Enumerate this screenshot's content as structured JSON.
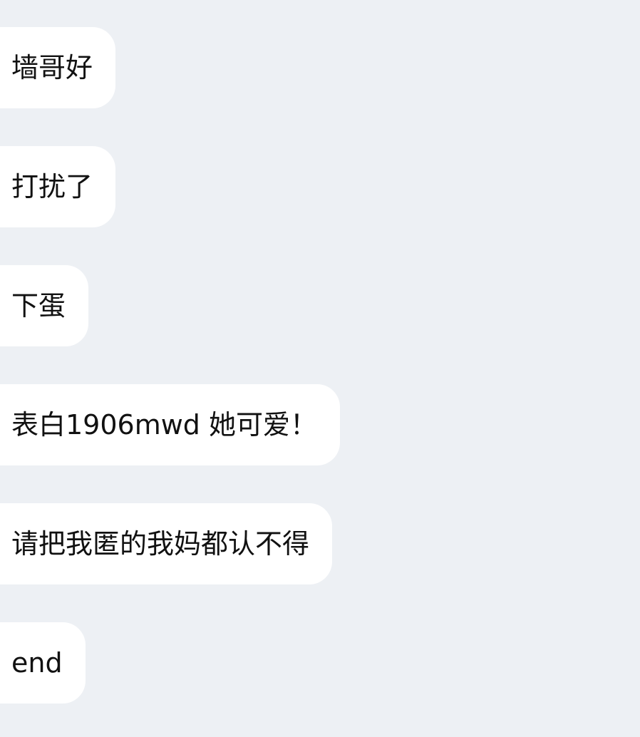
{
  "chat": {
    "messages": [
      {
        "text": "墙哥好"
      },
      {
        "text": "打扰了"
      },
      {
        "text": "下蛋"
      },
      {
        "text": "表白1906mwd 她可爱！"
      },
      {
        "text": "请把我匿的我妈都认不得"
      },
      {
        "text": "end"
      }
    ]
  },
  "colors": {
    "background": "#edf0f4",
    "bubble": "#ffffff",
    "text": "#111111"
  }
}
